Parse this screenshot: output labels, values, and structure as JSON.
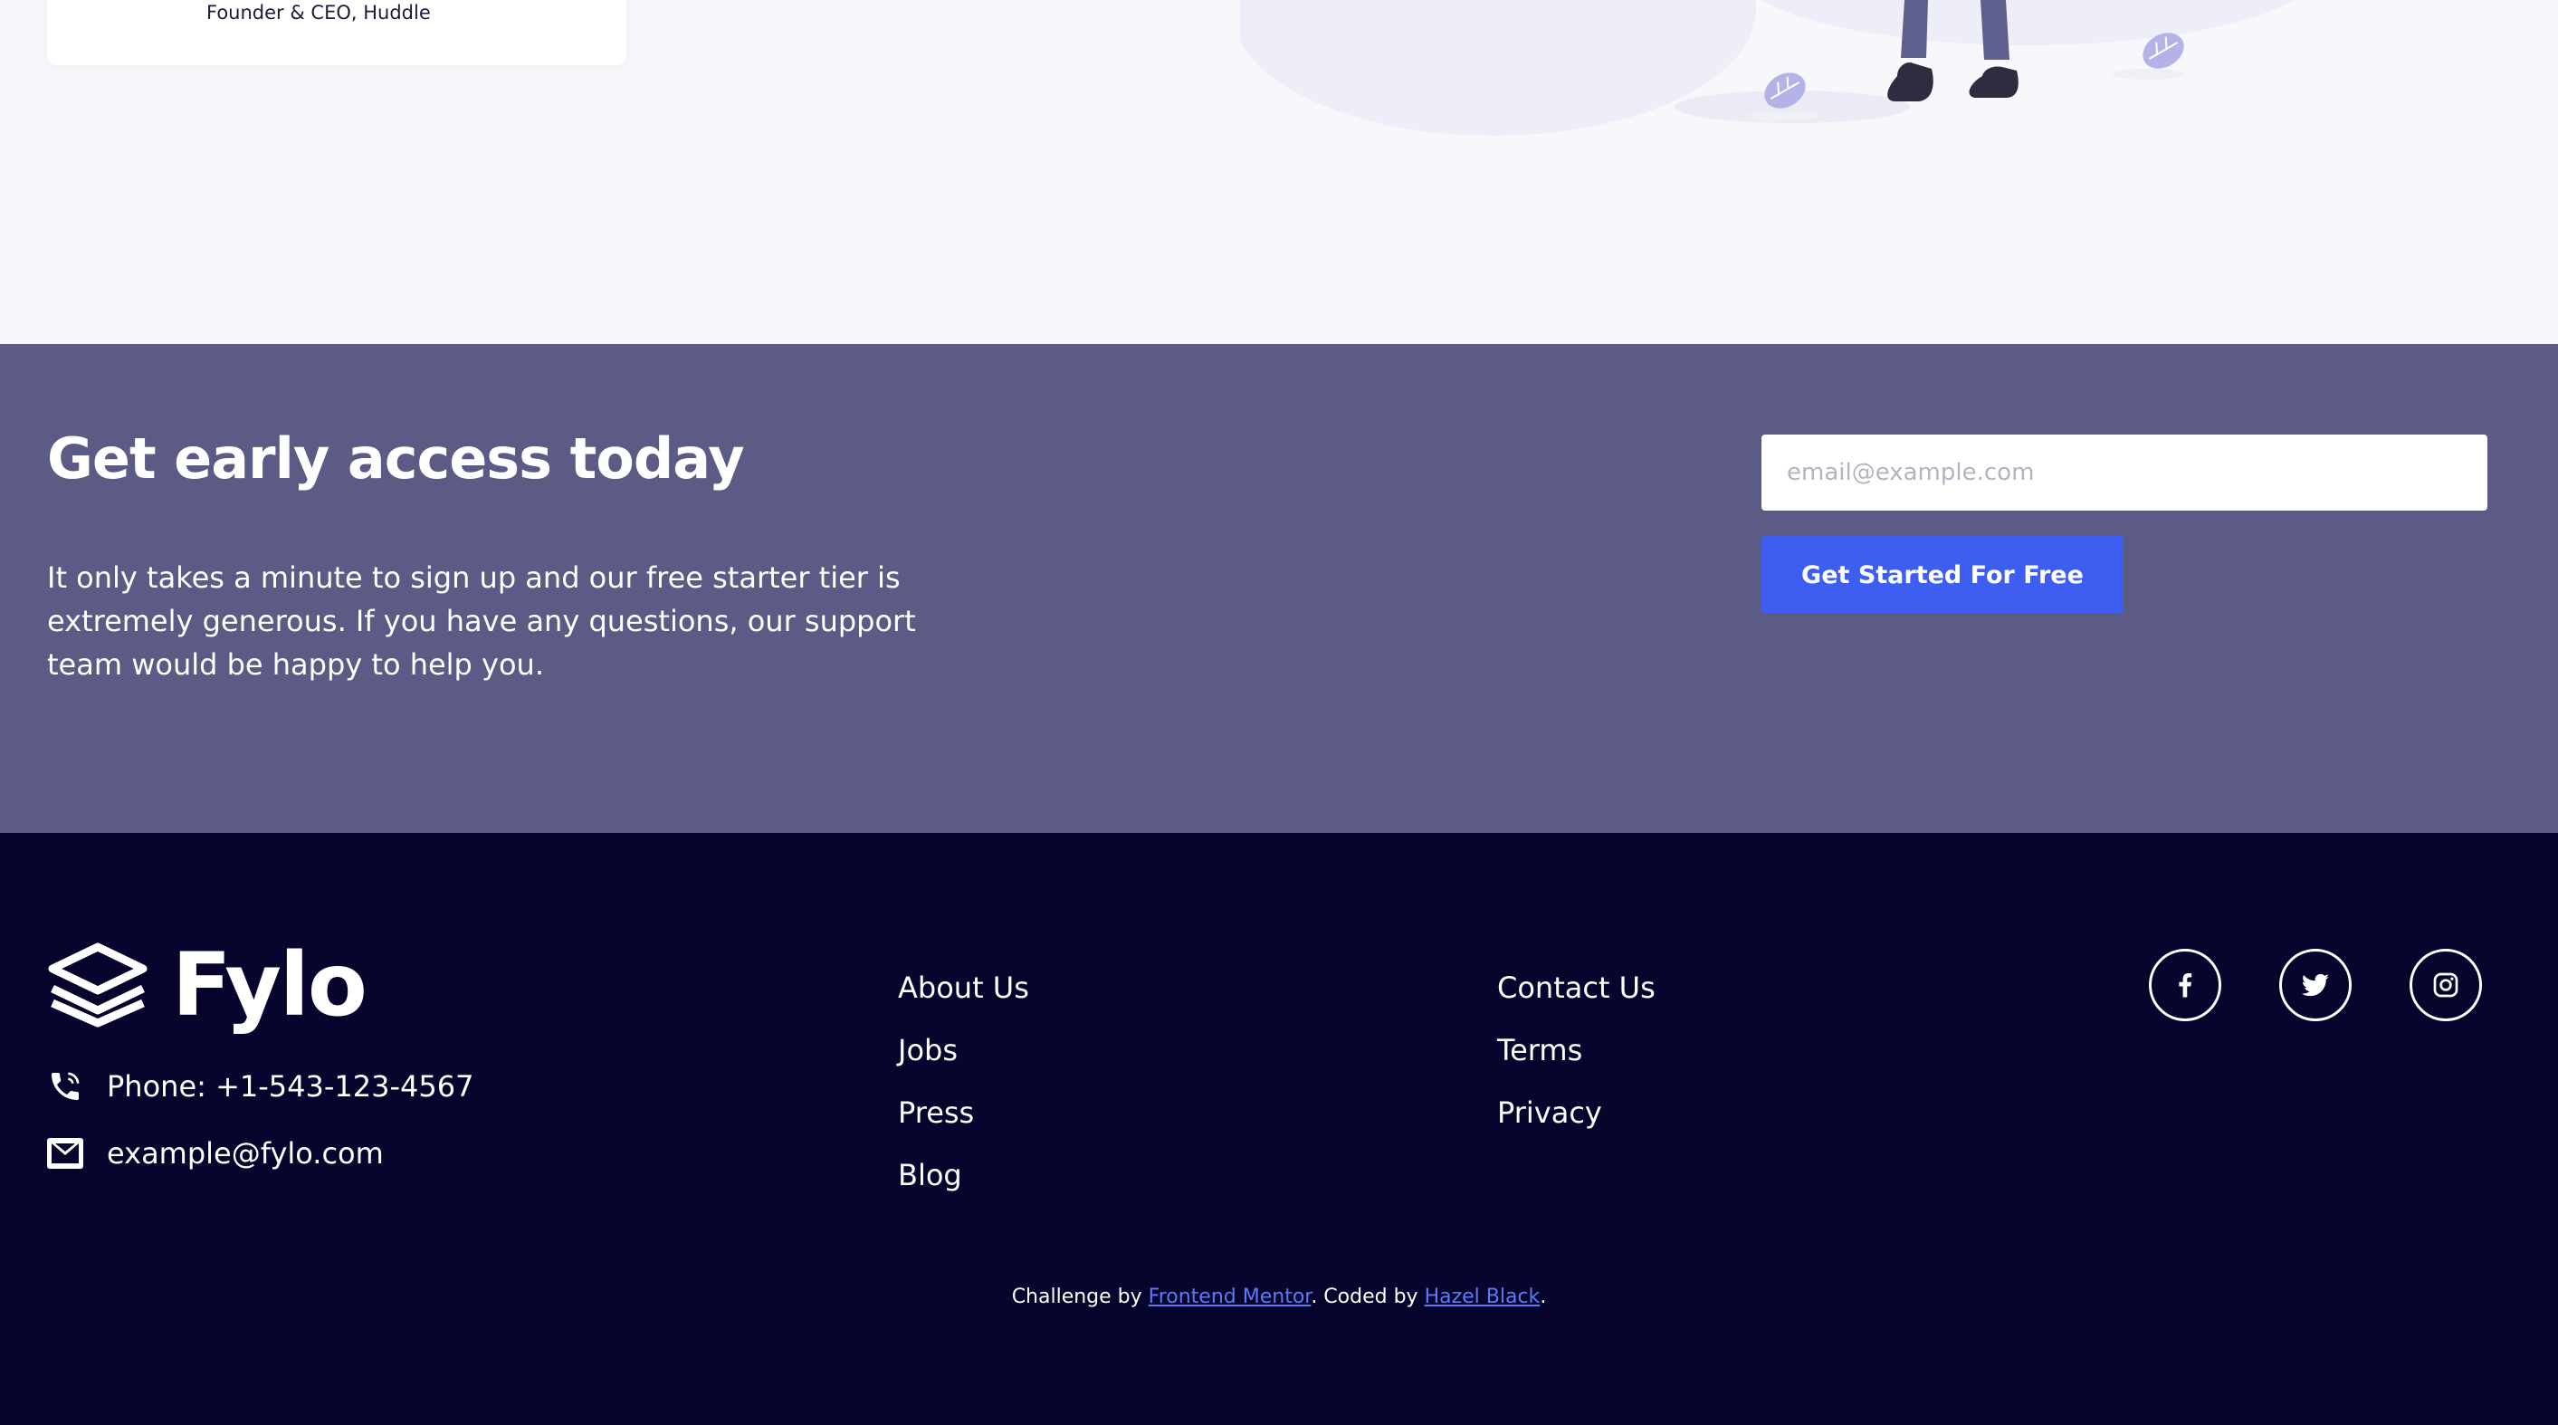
{
  "testimonial": {
    "role": "Founder & CEO, Huddle"
  },
  "cta": {
    "title": "Get early access today",
    "text": "It only takes a minute to sign up and our free starter tier is extremely generous. If you have any questions, our support team would be happy to help you.",
    "email_placeholder": "email@example.com",
    "button_label": "Get Started For Free"
  },
  "footer": {
    "logo_text": "Fylo",
    "phone": "Phone: +1-543-123-4567",
    "email": "example@fylo.com",
    "links_col1": [
      "About Us",
      "Jobs",
      "Press",
      "Blog"
    ],
    "links_col2": [
      "Contact Us",
      "Terms",
      "Privacy"
    ],
    "social_icons": [
      "facebook-icon",
      "twitter-icon",
      "instagram-icon"
    ],
    "credits": {
      "prefix": "Challenge by ",
      "link1": "Frontend Mentor",
      "middle": ". Coded by ",
      "link2": "Hazel Black",
      "suffix": "."
    }
  },
  "colors": {
    "cta_bg": "#5b5b86",
    "footer_bg": "#07052e",
    "button": "#3d5ef0",
    "link": "#5b7af5",
    "page_bg": "#f7f7fc"
  }
}
